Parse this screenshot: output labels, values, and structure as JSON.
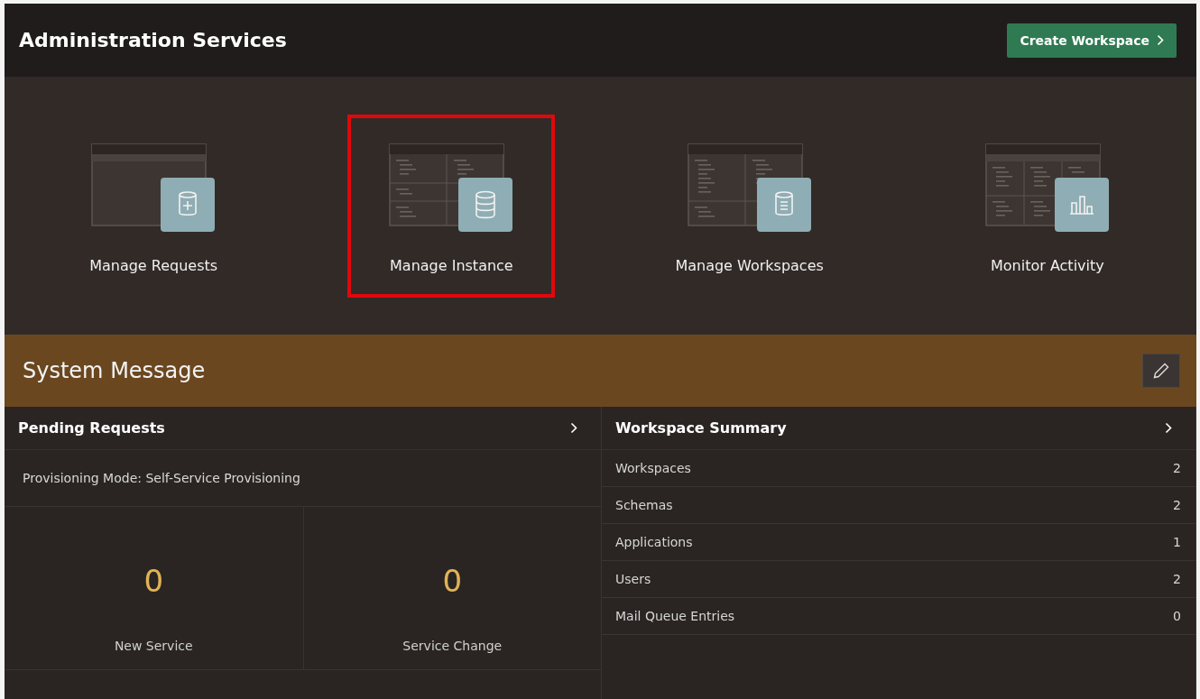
{
  "header": {
    "title": "Administration Services",
    "action": "Create Workspace"
  },
  "tiles": [
    {
      "label": "Manage Requests",
      "kind": "requests",
      "highlighted": false
    },
    {
      "label": "Manage Instance",
      "kind": "instance",
      "highlighted": true
    },
    {
      "label": "Manage Workspaces",
      "kind": "workspaces",
      "highlighted": false
    },
    {
      "label": "Monitor Activity",
      "kind": "activity",
      "highlighted": false
    }
  ],
  "system_message": {
    "title": "System Message"
  },
  "pending_requests": {
    "title": "Pending Requests",
    "mode": "Provisioning Mode: Self-Service Provisioning",
    "counts": [
      {
        "value": "0",
        "label": "New Service"
      },
      {
        "value": "0",
        "label": "Service Change"
      }
    ]
  },
  "workspace_summary": {
    "title": "Workspace Summary",
    "rows": [
      {
        "label": "Workspaces",
        "value": "2"
      },
      {
        "label": "Schemas",
        "value": "2"
      },
      {
        "label": "Applications",
        "value": "1"
      },
      {
        "label": "Users",
        "value": "2"
      },
      {
        "label": "Mail Queue Entries",
        "value": "0"
      }
    ]
  }
}
